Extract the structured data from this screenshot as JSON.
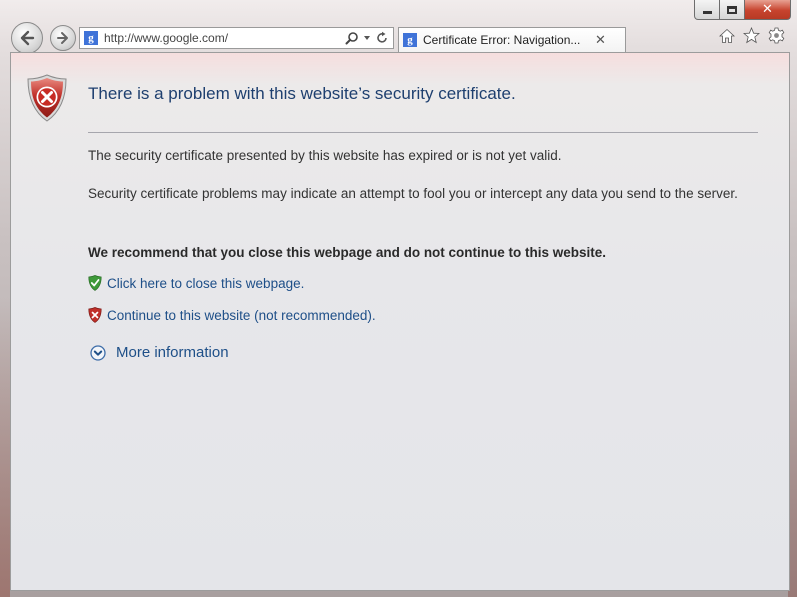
{
  "window": {
    "caption": {
      "minimize": "",
      "maximize": "",
      "close": "✕"
    }
  },
  "toolbar": {
    "address": {
      "favicon": "g",
      "url": "http://www.google.com/"
    },
    "tab": {
      "favicon": "g",
      "title": "Certificate Error: Navigation...",
      "close": "✕"
    },
    "icons": [
      "back-arrow-icon",
      "forward-arrow-icon",
      "search-icon",
      "dropdown-icon",
      "refresh-icon",
      "home-icon",
      "favorites-star-icon",
      "gear-icon"
    ]
  },
  "page": {
    "title": "There is a problem with this website’s security certificate.",
    "paragraph1": "The security certificate presented by this website has expired or is not yet valid.",
    "paragraph2": "Security certificate problems may indicate an attempt to fool you or intercept any data you send to the server.",
    "recommendation": "We recommend that you close this webpage and do not continue to this website.",
    "close_link": "Click here to close this webpage.",
    "continue_link": "Continue to this website (not recommended).",
    "more_info": "More information"
  },
  "colors": {
    "title": "#1e3f6f",
    "link": "#1e4f88",
    "shield_red": "#c0302a",
    "shield_green": "#3f9a3a"
  }
}
